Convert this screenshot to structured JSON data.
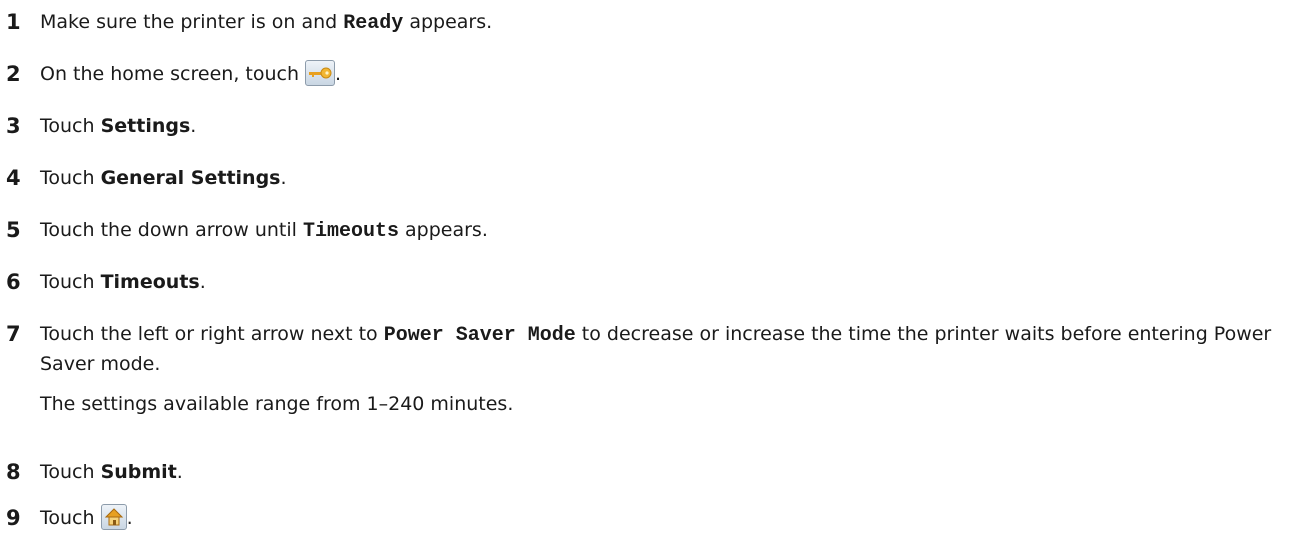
{
  "steps": [
    {
      "num": "1",
      "pre": "Make sure the printer is on and ",
      "code": "Ready",
      "post": " appears."
    },
    {
      "num": "2",
      "pre": "On the home screen, touch ",
      "icon": "key-icon",
      "post": "."
    },
    {
      "num": "3",
      "pre": "Touch ",
      "bold": "Settings",
      "post": "."
    },
    {
      "num": "4",
      "pre": "Touch ",
      "bold": "General Settings",
      "post": "."
    },
    {
      "num": "5",
      "pre": "Touch the down arrow until ",
      "code": "Timeouts",
      "post": " appears."
    },
    {
      "num": "6",
      "pre": "Touch ",
      "bold": "Timeouts",
      "post": "."
    },
    {
      "num": "7",
      "pre": "Touch the left or right arrow next to ",
      "code": "Power Saver Mode",
      "post": " to decrease or increase the time the printer waits before entering Power Saver mode.",
      "note": "The settings available range from 1–240 minutes."
    },
    {
      "num": "8",
      "pre": "Touch ",
      "bold": "Submit",
      "post": "."
    },
    {
      "num": "9",
      "pre": "Touch ",
      "icon": "home-icon",
      "post": "."
    }
  ]
}
